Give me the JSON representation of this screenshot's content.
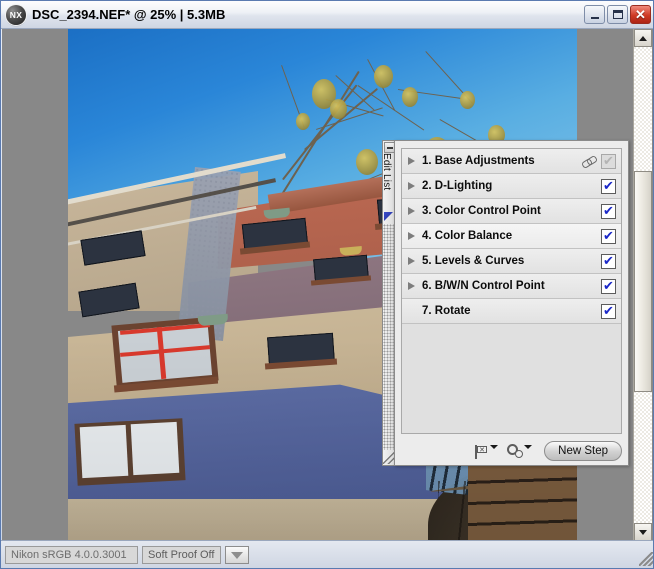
{
  "window": {
    "title": "DSC_2394.NEF* @ 25% | 5.3MB",
    "logo_text": "NX",
    "minimize_label": "",
    "maximize_label": "",
    "close_label": "✕"
  },
  "editlist": {
    "tab_label": "Edit List",
    "steps": [
      {
        "number": "1.",
        "label": "1. Base Adjustments",
        "expandable": true,
        "has_chain": true,
        "checked": true,
        "enabled": false
      },
      {
        "number": "2.",
        "label": "2. D-Lighting",
        "expandable": true,
        "has_chain": false,
        "checked": true,
        "enabled": true
      },
      {
        "number": "3.",
        "label": "3. Color Control Point",
        "expandable": true,
        "has_chain": false,
        "checked": true,
        "enabled": true
      },
      {
        "number": "4.",
        "label": "4. Color Balance",
        "expandable": true,
        "has_chain": false,
        "checked": true,
        "enabled": true
      },
      {
        "number": "5.",
        "label": "5. Levels & Curves",
        "expandable": true,
        "has_chain": false,
        "checked": true,
        "enabled": true
      },
      {
        "number": "6.",
        "label": "6. B/W/N Control Point",
        "expandable": true,
        "has_chain": false,
        "checked": true,
        "enabled": true
      },
      {
        "number": "7.",
        "label": "7. Rotate",
        "expandable": false,
        "has_chain": false,
        "checked": true,
        "enabled": true
      }
    ],
    "checkmark": "✔",
    "tools": {
      "flag_icon": "flag-icon",
      "gear_icon": "gears-icon",
      "new_step_label": "New Step"
    }
  },
  "statusbar": {
    "color_profile": "Nikon sRGB 4.0.0.3001",
    "soft_proof": "Soft Proof Off",
    "dropdown_icon": "chevron-down-icon"
  },
  "scrollbar": {
    "up_icon": "scroll-up-icon",
    "down_icon": "scroll-down-icon"
  },
  "photo": {
    "description": "Hundertwasser House facade with bare tree and blue sky"
  }
}
